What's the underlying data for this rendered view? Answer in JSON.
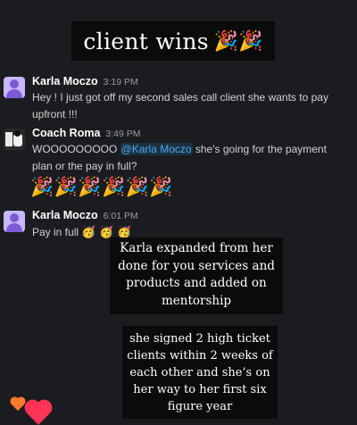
{
  "title": {
    "text": "client wins",
    "popper": "🎉🎉"
  },
  "messages": [
    {
      "author": "Karla Moczo",
      "time": "3:19 PM",
      "text": "Hey ! I just got off my second sales call client she wants to pay upfront !!!"
    },
    {
      "author": "Coach Roma",
      "time": "3:49 PM",
      "text_before": "WOOOOOOOOO ",
      "mention": "@Karla Moczo",
      "text_after": " she's going for the payment plan or the pay in full?",
      "reactions": "🎉🎉🎉🎉🎉🎉"
    },
    {
      "author": "Karla Moczo",
      "time": "6:01 PM",
      "text": "Pay in full",
      "emojis": "🥳 🥳 🥳"
    }
  ],
  "captions": {
    "first": "Karla expanded from her done for you services and products and added on mentorship",
    "second": "she signed 2 high ticket clients within 2 weeks of each other and she’s on her way to her first six figure year"
  },
  "colors": {
    "background": "#1b1c1f",
    "mention": "#4ea6f0",
    "caption_bg": "#0b0b0b"
  },
  "icons": [
    "party-popper-icon",
    "orange-heart-icon",
    "red-heart-icon"
  ]
}
